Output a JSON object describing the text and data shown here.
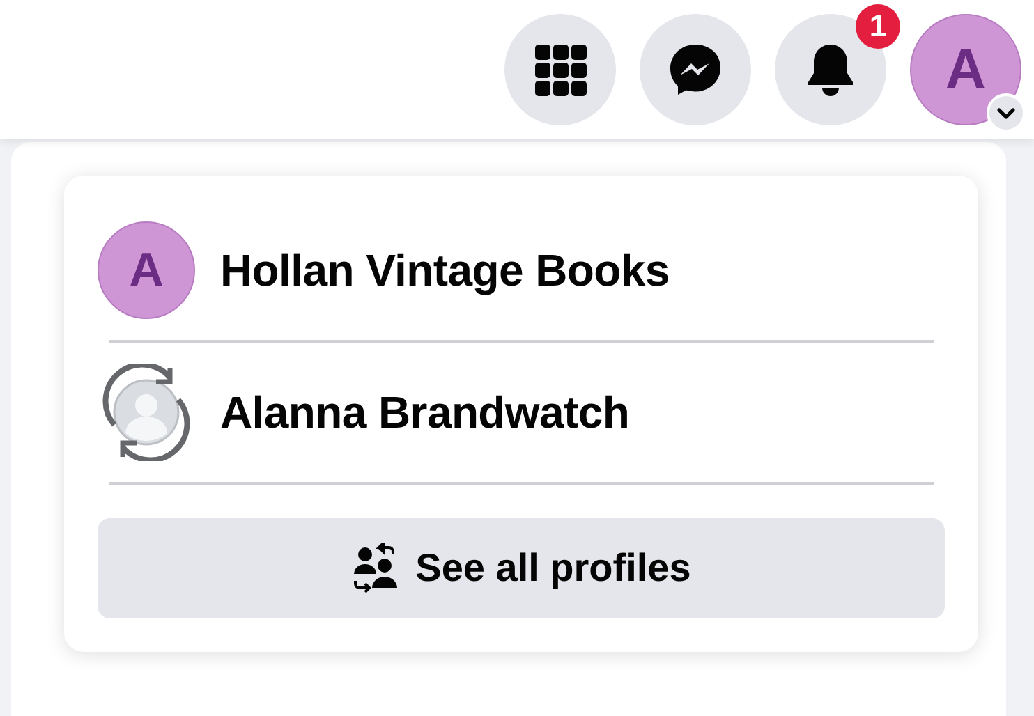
{
  "top_bar": {
    "notification_badge": "1",
    "account_avatar": "A"
  },
  "profile_menu": {
    "profiles": [
      {
        "kind": "page",
        "avatar_letter": "A",
        "name": "Hollan Vintage Books"
      },
      {
        "kind": "switch",
        "name": "Alanna Brandwatch"
      }
    ],
    "see_all_button": "See all profiles"
  }
}
